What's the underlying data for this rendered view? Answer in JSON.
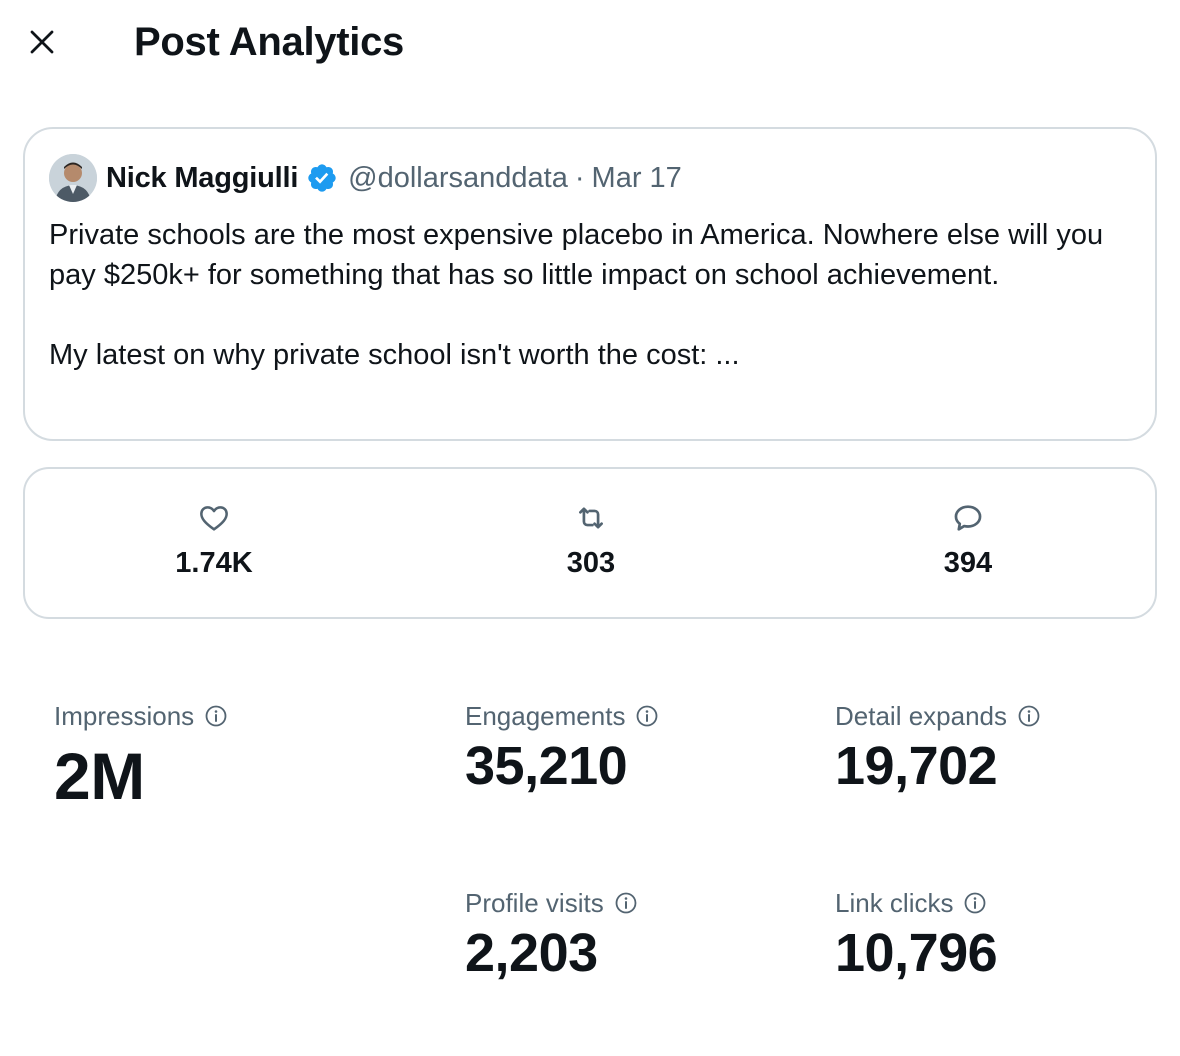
{
  "header": {
    "title": "Post Analytics",
    "close_icon": "close-icon"
  },
  "post": {
    "author_name": "Nick Maggiulli",
    "verified": true,
    "handle": "@dollarsanddata",
    "separator": "·",
    "date": "Mar 17",
    "text": "Private schools are the most expensive placebo in America. Nowhere else will you pay $250k+ for something that has so little impact on school achievement.\n\nMy latest on why private school isn't worth the cost: ..."
  },
  "stats": {
    "likes": {
      "icon": "heart-icon",
      "value": "1.74K"
    },
    "reposts": {
      "icon": "repost-icon",
      "value": "303"
    },
    "replies": {
      "icon": "reply-icon",
      "value": "394"
    }
  },
  "metrics": {
    "impressions": {
      "label": "Impressions",
      "value": "2M"
    },
    "engagements": {
      "label": "Engagements",
      "value": "35,210"
    },
    "detail_expands": {
      "label": "Detail expands",
      "value": "19,702"
    },
    "profile_visits": {
      "label": "Profile visits",
      "value": "2,203"
    },
    "link_clicks": {
      "label": "Link clicks",
      "value": "10,796"
    }
  },
  "colors": {
    "text_primary": "#0f1419",
    "text_secondary": "#536471",
    "border": "#d4dbe0",
    "verified_blue": "#1d9bf0"
  }
}
